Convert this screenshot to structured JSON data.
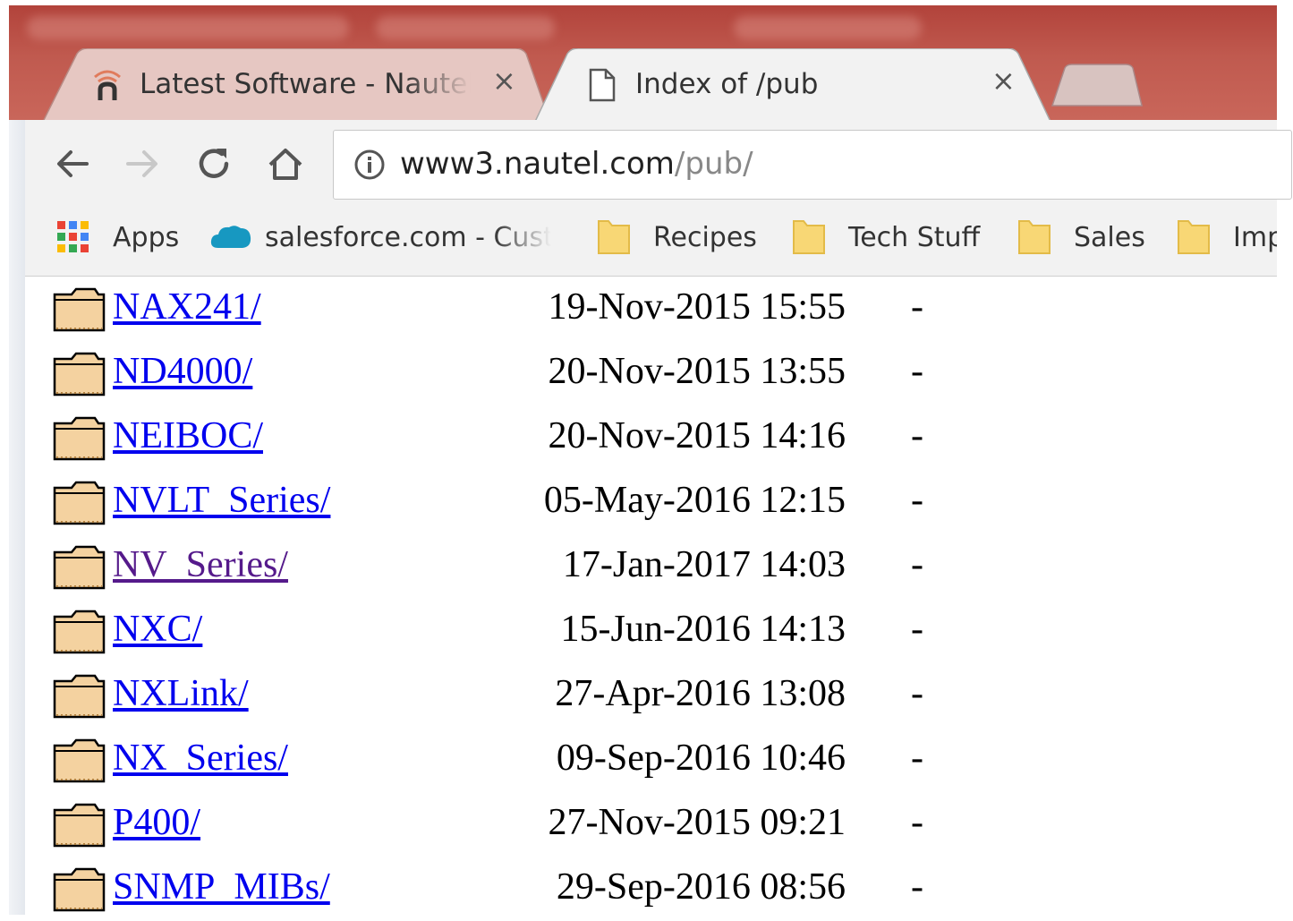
{
  "tabs": [
    {
      "title": "Latest Software - Nautel",
      "close": "×",
      "icon": "nautel-logo-icon",
      "active": false
    },
    {
      "title": "Index of /pub",
      "close": "×",
      "icon": "document-icon",
      "active": true
    }
  ],
  "address_bar": {
    "host": "www3.nautel.com",
    "path": "/pub/",
    "security_icon": "info-icon"
  },
  "bookmarks": [
    {
      "label": "Apps",
      "icon": "apps-grid-icon"
    },
    {
      "label": "salesforce.com - Cust",
      "icon": "salesforce-cloud-icon"
    },
    {
      "label": "Recipes",
      "icon": "folder-icon"
    },
    {
      "label": "Tech Stuff",
      "icon": "folder-icon"
    },
    {
      "label": "Sales",
      "icon": "folder-icon"
    },
    {
      "label": "Imp",
      "icon": "folder-icon"
    }
  ],
  "listing": [
    {
      "name": "NAX241/",
      "modified": "19-Nov-2015 15:55",
      "size": "-",
      "visited": false
    },
    {
      "name": "ND4000/",
      "modified": "20-Nov-2015 13:55",
      "size": "-",
      "visited": false
    },
    {
      "name": "NEIBOC/",
      "modified": "20-Nov-2015 14:16",
      "size": "-",
      "visited": false
    },
    {
      "name": "NVLT_Series/",
      "modified": "05-May-2016 12:15",
      "size": "-",
      "visited": false
    },
    {
      "name": "NV_Series/",
      "modified": "17-Jan-2017 14:03",
      "size": "-",
      "visited": true
    },
    {
      "name": "NXC/",
      "modified": "15-Jun-2016 14:13",
      "size": "-",
      "visited": false
    },
    {
      "name": "NXLink/",
      "modified": "27-Apr-2016 13:08",
      "size": "-",
      "visited": false
    },
    {
      "name": "NX_Series/",
      "modified": "09-Sep-2016 10:46",
      "size": "-",
      "visited": false
    },
    {
      "name": "P400/",
      "modified": "27-Nov-2015 09:21",
      "size": "-",
      "visited": false
    },
    {
      "name": "SNMP_MIBs/",
      "modified": "29-Sep-2016 08:56",
      "size": "-",
      "visited": false
    }
  ],
  "colors": {
    "link": "#0000ee",
    "visited_link": "#551a8b",
    "titlebar": "#c05a4f",
    "toolbar": "#f2f2f2",
    "folder_fill": "#f4d2a0"
  }
}
